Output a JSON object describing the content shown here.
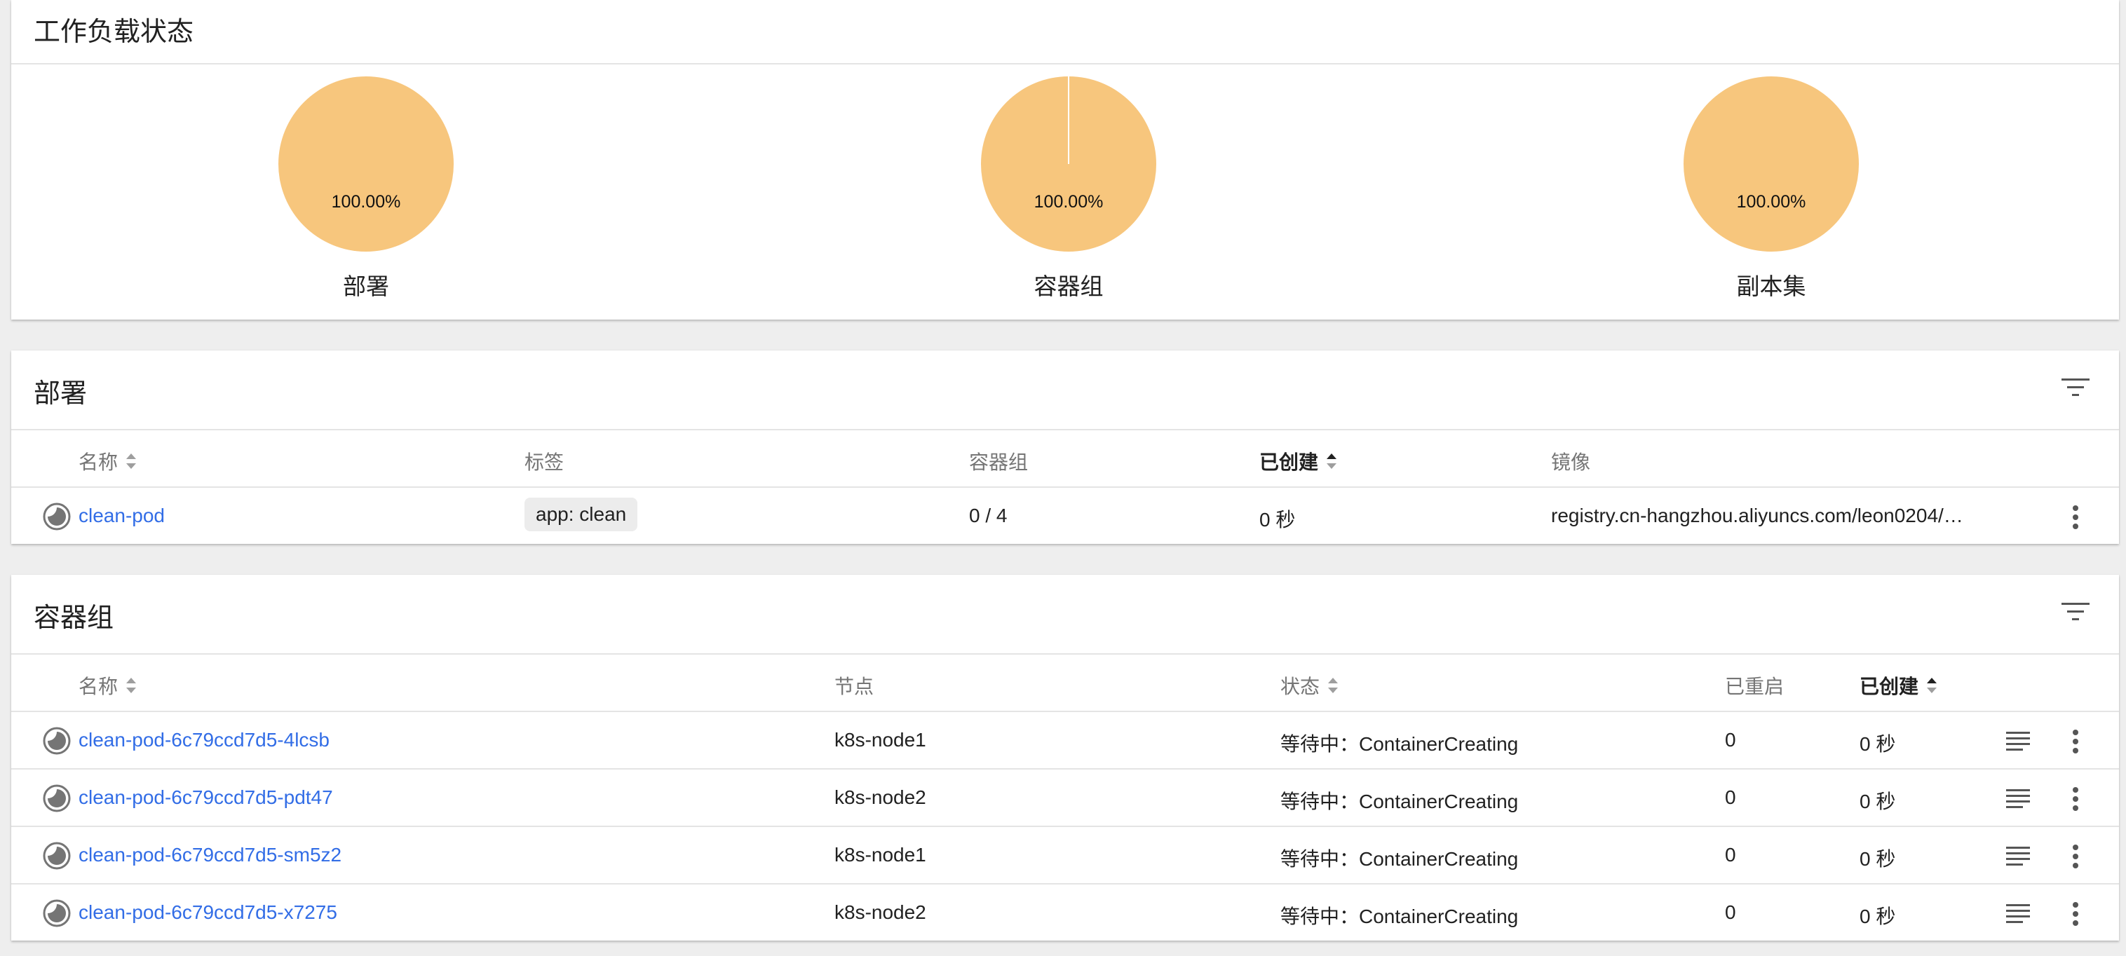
{
  "workload_status": {
    "title": "工作负载状态",
    "pies": [
      {
        "label": "部署",
        "percent_text": "100.00%",
        "color": "#f7c67d"
      },
      {
        "label": "容器组",
        "percent_text": "100.00%",
        "color": "#f7c67d"
      },
      {
        "label": "副本集",
        "percent_text": "100.00%",
        "color": "#f7c67d"
      }
    ]
  },
  "deployments": {
    "title": "部署",
    "filter_icon": "filter-list-icon",
    "columns": {
      "name": "名称",
      "labels": "标签",
      "pods": "容器组",
      "created": "已创建",
      "images": "镜像"
    },
    "rows": [
      {
        "name": "clean-pod",
        "label": "app: clean",
        "pods": "0 / 4",
        "created": "0 秒",
        "image": "registry.cn-hangzhou.aliyuncs.com/leon0204/…"
      }
    ]
  },
  "pods": {
    "title": "容器组",
    "filter_icon": "filter-list-icon",
    "columns": {
      "name": "名称",
      "node": "节点",
      "status": "状态",
      "restarts": "已重启",
      "created": "已创建"
    },
    "rows": [
      {
        "name": "clean-pod-6c79ccd7d5-4lcsb",
        "node": "k8s-node1",
        "status": "等待中：ContainerCreating",
        "restarts": "0",
        "created": "0 秒"
      },
      {
        "name": "clean-pod-6c79ccd7d5-pdt47",
        "node": "k8s-node2",
        "status": "等待中：ContainerCreating",
        "restarts": "0",
        "created": "0 秒"
      },
      {
        "name": "clean-pod-6c79ccd7d5-sm5z2",
        "node": "k8s-node1",
        "status": "等待中：ContainerCreating",
        "restarts": "0",
        "created": "0 秒"
      },
      {
        "name": "clean-pod-6c79ccd7d5-x7275",
        "node": "k8s-node2",
        "status": "等待中：ContainerCreating",
        "restarts": "0",
        "created": "0 秒"
      }
    ]
  },
  "colors": {
    "link": "#326de6",
    "pie": "#f7c67d",
    "background": "#eeeeee"
  }
}
